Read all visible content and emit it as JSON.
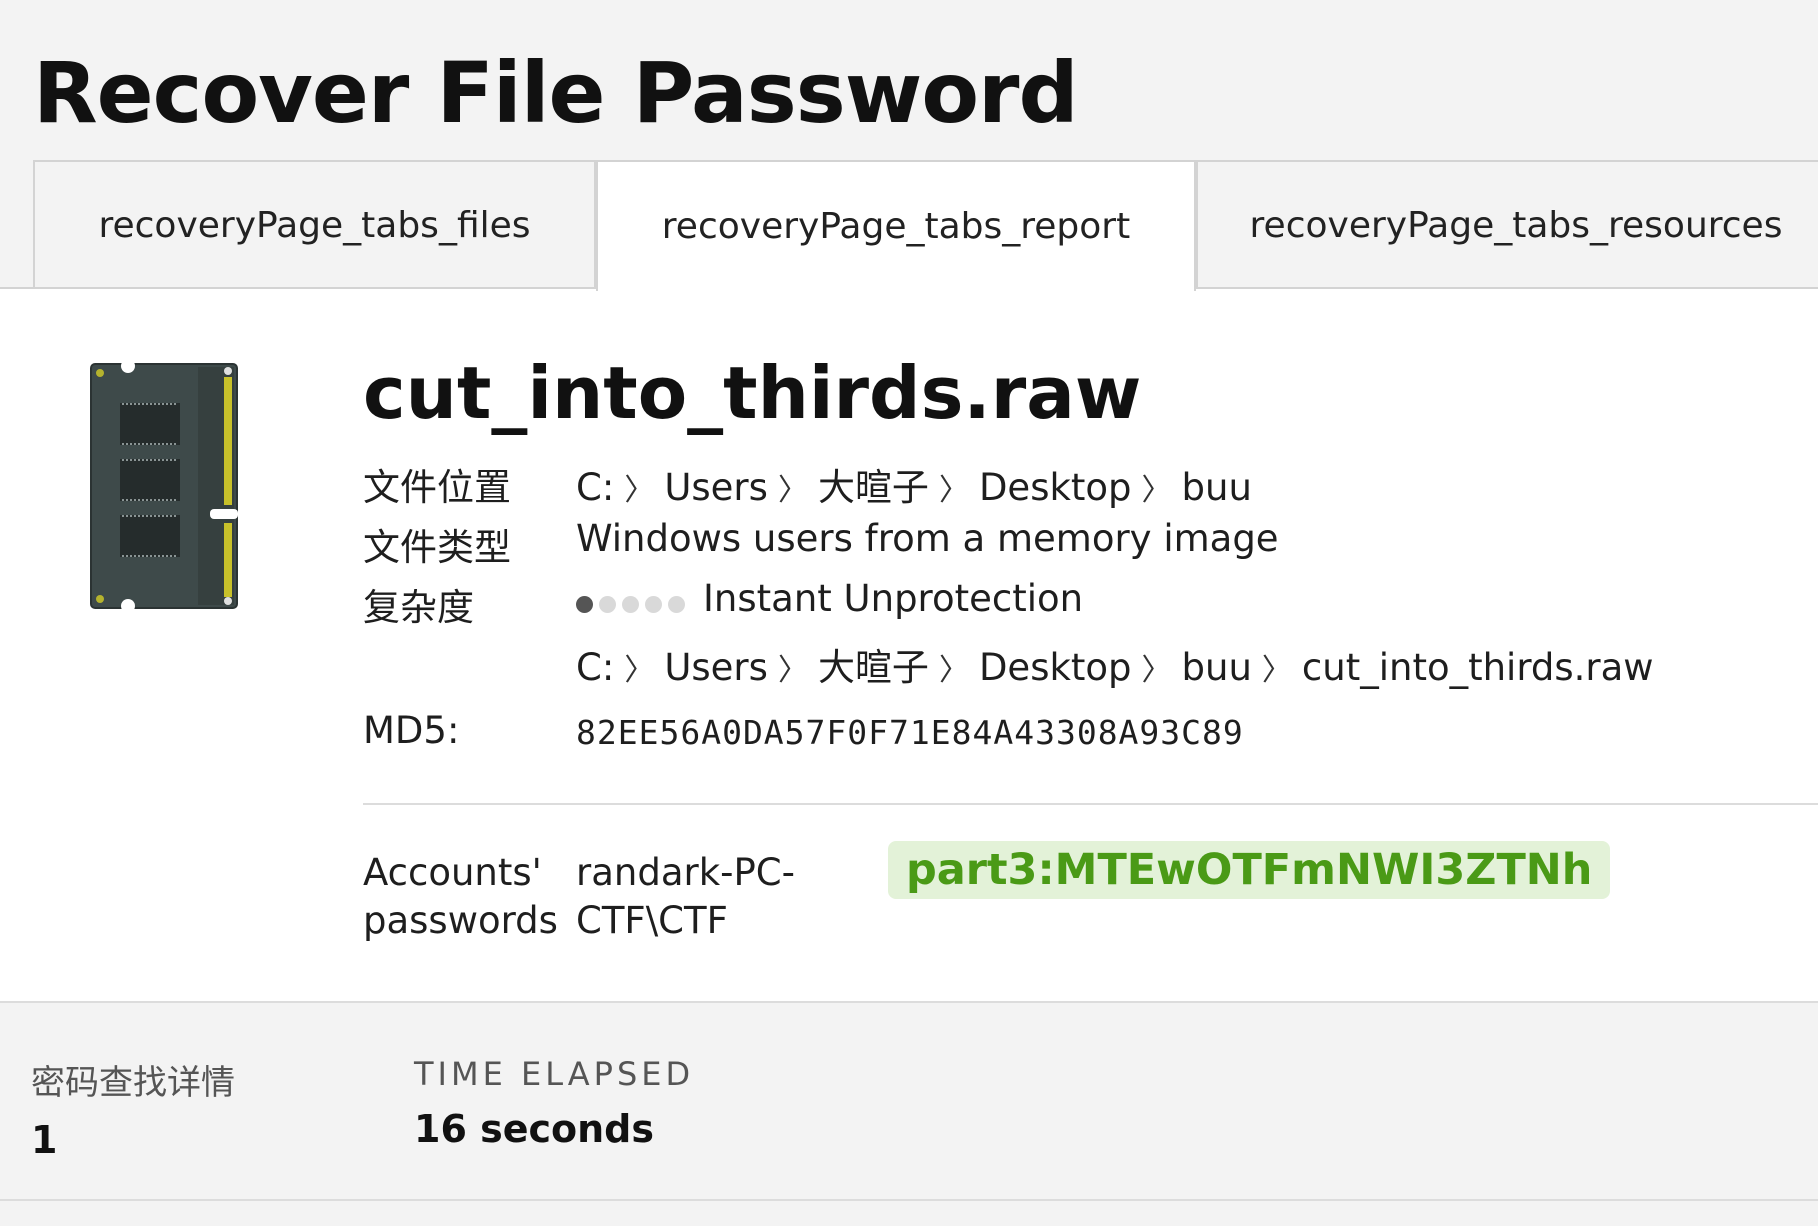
{
  "page": {
    "title": "Recover File Password"
  },
  "tabs": [
    {
      "label": "recoveryPage_tabs_files",
      "active": false
    },
    {
      "label": "recoveryPage_tabs_report",
      "active": true
    },
    {
      "label": "recoveryPage_tabs_resources",
      "active": false
    }
  ],
  "file": {
    "icon": "memory-module-icon",
    "name": "cut_into_thirds.raw",
    "location_label": "文件位置",
    "location_path": [
      "C:",
      "Users",
      "大暄子",
      "Desktop",
      "buu"
    ],
    "type_label": "文件类型",
    "type_value": "Windows users from a memory image",
    "complexity_label": "复杂度",
    "complexity_level": 1,
    "complexity_max": 5,
    "complexity_text": "Instant Unprotection",
    "full_path": [
      "C:",
      "Users",
      "大暄子",
      "Desktop",
      "buu",
      "cut_into_thirds.raw"
    ],
    "md5_label": "MD5:",
    "md5_value": "82EE56A0DA57F0F71E84A43308A93C89"
  },
  "accounts": {
    "label_line1": "Accounts'",
    "label_line2": "passwords",
    "user_line1": "randark-PC-",
    "user_line2": "CTF\\CTF",
    "password": "part3:MTEwOTFmNWI3ZTNh",
    "password_color": "#4a9a16",
    "password_bg": "#e3f2d8"
  },
  "footer": {
    "found_label": "密码查找详情",
    "found_value": "1",
    "elapsed_label": "TIME ELAPSED",
    "elapsed_value": "16 seconds"
  },
  "separator": "〉"
}
